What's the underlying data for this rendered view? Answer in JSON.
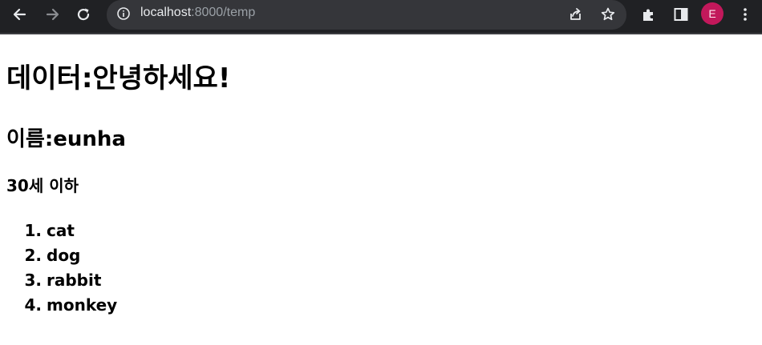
{
  "browser": {
    "url_host": "localhost",
    "url_rest": ":8000/temp",
    "profile_initial": "E",
    "profile_color": "#c2185b",
    "icons": [
      "back-icon",
      "forward-icon",
      "reload-icon",
      "info-icon",
      "share-icon",
      "star-icon",
      "extensions-icon",
      "side-panel-icon",
      "kebab-menu-icon"
    ]
  },
  "page": {
    "heading1": "데이터:안녕하세요!",
    "heading2": "이름:eunha",
    "heading3": "30세 이하",
    "list": [
      {
        "num": "1.",
        "text": "cat"
      },
      {
        "num": "2.",
        "text": "dog"
      },
      {
        "num": "3.",
        "text": "rabbit"
      },
      {
        "num": "4.",
        "text": "monkey"
      }
    ]
  }
}
